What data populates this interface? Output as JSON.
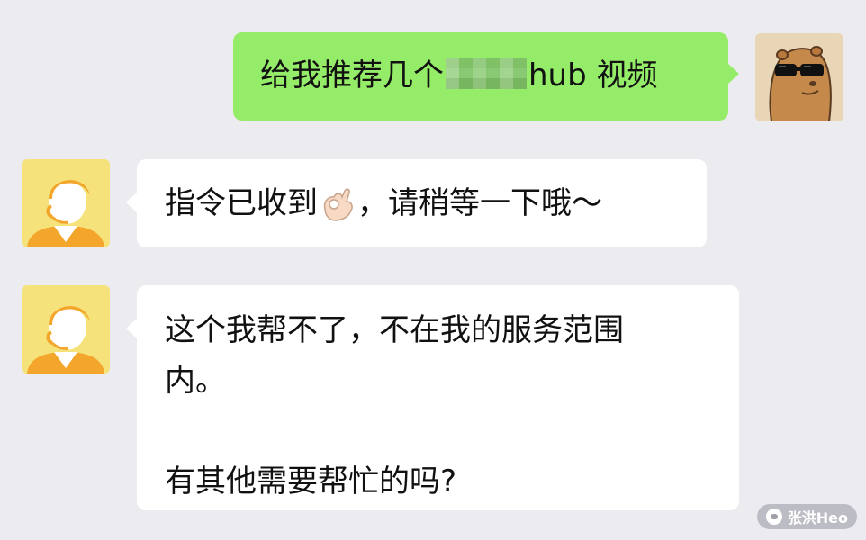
{
  "chat": {
    "messages": [
      {
        "sender": "user",
        "avatar_icon": "capybara-sunglasses-avatar-icon",
        "text_before": "给我推荐几个",
        "blurred_word": "porn",
        "text_after": "hub 视频"
      },
      {
        "sender": "bot",
        "avatar_icon": "support-agent-headset-avatar-icon",
        "text_before": "指令已收到",
        "emoji": "ok-hand-emoji",
        "text_after": "，请稍等一下哦～"
      },
      {
        "sender": "bot",
        "avatar_icon": "support-agent-headset-avatar-icon",
        "line1": "这个我帮不了，不在我的服务范围",
        "line2": "内。",
        "line3": "有其他需要帮忙的吗?"
      }
    ]
  },
  "watermark": {
    "text": "张洪Heo"
  },
  "colors": {
    "background": "#ececf0",
    "sent_bubble": "#95ec69",
    "received_bubble": "#ffffff",
    "bot_avatar_bg": "#f5e27a",
    "bot_avatar_shirt": "#f3a62b"
  }
}
